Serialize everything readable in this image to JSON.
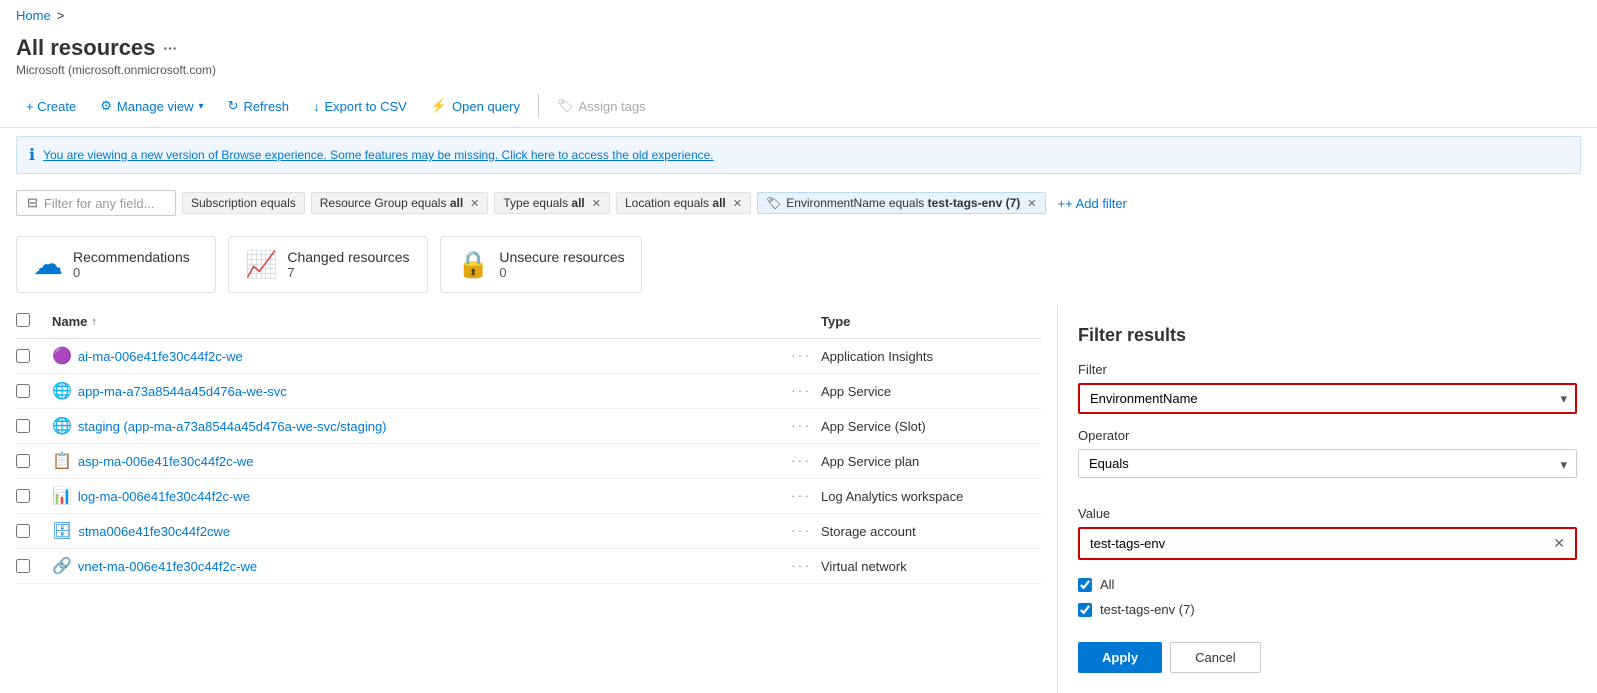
{
  "breadcrumb": {
    "home": "Home",
    "separator": ">"
  },
  "page": {
    "title": "All resources",
    "more_icon": "···",
    "subtitle": "Microsoft (microsoft.onmicrosoft.com)"
  },
  "toolbar": {
    "create": "+ Create",
    "manage_view": "Manage view",
    "refresh": "Refresh",
    "export_csv": "Export to CSV",
    "open_query": "Open query",
    "assign_tags": "Assign tags"
  },
  "info_banner": {
    "text": "You are viewing a new version of Browse experience. Some features may be missing. Click here to access the old experience.",
    "icon": "ℹ"
  },
  "filters": {
    "placeholder": "Filter for any field...",
    "chips": [
      {
        "label": "Subscription equals",
        "bold": "",
        "removable": false
      },
      {
        "label": "Resource Group equals ",
        "bold": "all",
        "removable": true
      },
      {
        "label": "Type equals ",
        "bold": "all",
        "removable": true
      },
      {
        "label": "Location equals ",
        "bold": "all",
        "removable": true
      },
      {
        "label": "EnvironmentName equals ",
        "bold": "test-tags-env (7)",
        "removable": true,
        "highlighted": true,
        "icon": "🏷"
      }
    ],
    "add_filter": "+ Add filter"
  },
  "summary_cards": [
    {
      "icon": "☁",
      "label": "Recommendations",
      "count": "0"
    },
    {
      "icon": "📈",
      "label": "Changed resources",
      "count": "7"
    },
    {
      "icon": "🔒",
      "label": "Unsecure resources",
      "count": "0"
    }
  ],
  "table": {
    "columns": [
      "Name ↑",
      "",
      "Type"
    ],
    "rows": [
      {
        "icon": "💜",
        "name": "ai-ma-006e41fe30c44f2c-we",
        "type": "Application Insights"
      },
      {
        "icon": "🌐",
        "name": "app-ma-a73a8544a45d476a-we-svc",
        "type": "App Service"
      },
      {
        "icon": "🌐",
        "name": "staging (app-ma-a73a8544a45d476a-we-svc/staging)",
        "type": "App Service (Slot)"
      },
      {
        "icon": "📋",
        "name": "asp-ma-006e41fe30c44f2c-we",
        "type": "App Service plan"
      },
      {
        "icon": "📊",
        "name": "log-ma-006e41fe30c44f2c-we",
        "type": "Log Analytics workspace"
      },
      {
        "icon": "🗄",
        "name": "stma006e41fe30c44f2cwe",
        "type": "Storage account"
      },
      {
        "icon": "🔗",
        "name": "vnet-ma-006e41fe30c44f2c-we",
        "type": "Virtual network"
      }
    ]
  },
  "filter_panel": {
    "title": "Filter results",
    "filter_label": "Filter",
    "filter_value": "EnvironmentName",
    "operator_label": "Operator",
    "operator_value": "Equals",
    "value_label": "Value",
    "value_input": "test-tags-env",
    "checkboxes": [
      {
        "label": "All",
        "checked": true
      },
      {
        "label": "test-tags-env (7)",
        "checked": true
      }
    ],
    "apply_btn": "Apply",
    "cancel_btn": "Cancel"
  }
}
